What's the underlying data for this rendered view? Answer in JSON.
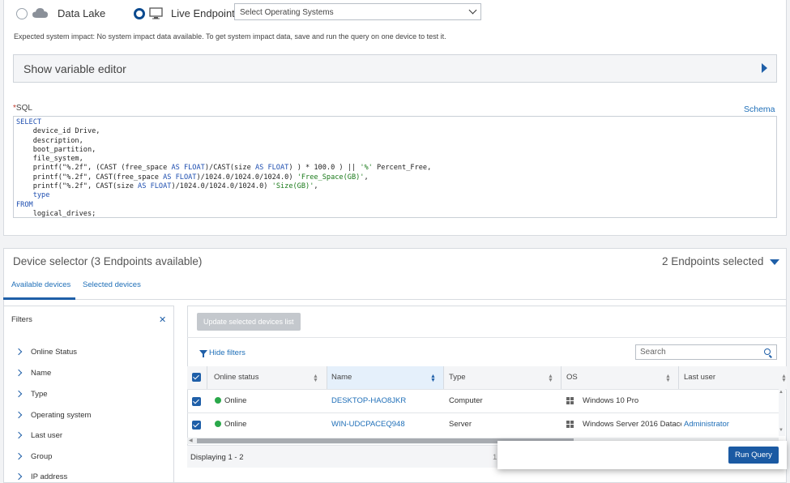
{
  "source": {
    "data_lake_label": "Data Lake",
    "live_endpoint_label": "Live Endpoint",
    "os_select_placeholder": "Select Operating Systems"
  },
  "impact": {
    "label": "Expected system impact:",
    "text": " No system impact data available. To get system impact data, save and run the query on one device to test it."
  },
  "variable_editor": {
    "label": "Show variable editor"
  },
  "sql": {
    "required_mark": "*",
    "label": "SQL",
    "schema_link": "Schema"
  },
  "device_selector": {
    "title": "Device selector (3 Endpoints available)",
    "selected_count": "2 Endpoints selected",
    "tabs": [
      "Available devices",
      "Selected devices"
    ]
  },
  "filters": {
    "title": "Filters",
    "items": [
      "Online Status",
      "Name",
      "Type",
      "Operating system",
      "Last user",
      "Group",
      "IP address"
    ]
  },
  "grid": {
    "update_button": "Update selected devices list",
    "hide_filters": "Hide filters",
    "search_placeholder": "Search",
    "columns": [
      "Online status",
      "Name",
      "Type",
      "OS",
      "Last user"
    ],
    "rows": [
      {
        "status": "Online",
        "name": "DESKTOP-HAO8JKR",
        "type": "Computer",
        "os": "Windows 10 Pro",
        "last_user": ""
      },
      {
        "status": "Online",
        "name": "WIN-UDCPACEQ948",
        "type": "Server",
        "os": "Windows Server 2016 Datace",
        "last_user": "Administrator"
      }
    ],
    "displaying": "Displaying 1 - 2",
    "page_partial": "1"
  },
  "actions": {
    "run_query": "Run Query"
  },
  "colors": {
    "accent": "#1f5fa8",
    "online": "#2aa84a"
  }
}
